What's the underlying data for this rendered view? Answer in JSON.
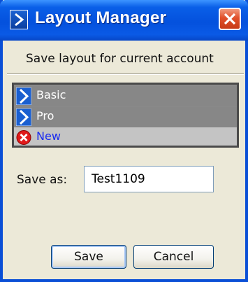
{
  "window": {
    "title": "Layout Manager",
    "prompt": "Save layout for current account"
  },
  "layouts": {
    "items": [
      {
        "label": "Basic",
        "icon": "chevron-right-icon",
        "style": "dark"
      },
      {
        "label": "Pro",
        "icon": "chevron-right-icon",
        "style": "dark"
      },
      {
        "label": "New",
        "icon": "red-x-icon",
        "style": "light"
      }
    ]
  },
  "save_form": {
    "label": "Save as:",
    "value": "Test1109"
  },
  "buttons": {
    "save_label": "Save",
    "cancel_label": "Cancel"
  },
  "colors": {
    "titlebar": "#0451dd",
    "window_bg": "#ece9d8",
    "close_button": "#e1502a",
    "new_item_text": "#1a2bf0"
  }
}
